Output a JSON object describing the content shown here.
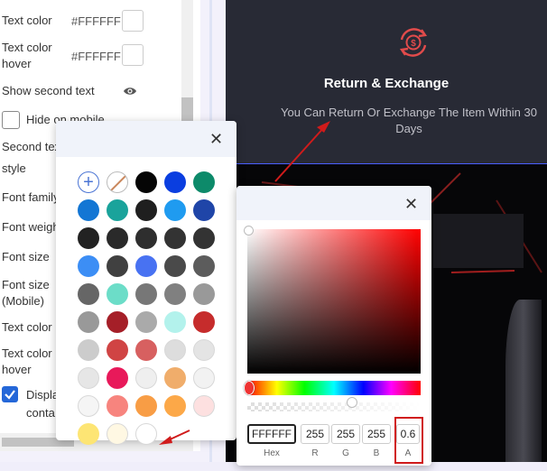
{
  "settings": {
    "text_color_label": "Text color",
    "text_color_value": "#FFFFFF",
    "text_color_hover_label": "Text color hover",
    "text_color_hover_value": "#FFFFFF",
    "show_second_text_label": "Show second text",
    "hide_on_mobile_label": "Hide on mobile",
    "second_text_label": "Second tex",
    "style_label": "style",
    "font_family_label": "Font family",
    "font_weight_label": "Font weigh",
    "font_size_label": "Font size",
    "font_size_mobile_label": "Font size (Mobile)",
    "text_color_label_2": "Text color",
    "text_color_hover_label_2": "Text color hover",
    "display_label": "Displa",
    "display_label_2": "conta",
    "hide_on_mobile_checked": false,
    "display_checked": true
  },
  "preview": {
    "title": "Return & Exchange",
    "text": "You Can Return Or Exchange The Item Within 30 Days",
    "icon": "return-exchange-dollar-icon"
  },
  "swatches": {
    "colors": [
      "#ffffff",
      "#ffffff",
      "#050505",
      "#0a3ee0",
      "#0d8a6a",
      "#1376d4",
      "#1aa39b",
      "#1f1f1f",
      "#1f9bf0",
      "#1f45a8",
      "#222222",
      "#2a2a2a",
      "#2e2e2e",
      "#333333",
      "#333333",
      "#3c8ef5",
      "#404040",
      "#4872f2",
      "#4a4a4a",
      "#5c5c5c",
      "#666666",
      "#6cddc8",
      "#777777",
      "#808080",
      "#999999",
      "#999999",
      "#a51f28",
      "#aaaaaa",
      "#b3f2ec",
      "#c62c2c",
      "#cccccc",
      "#d04444",
      "#d76060",
      "#dddddd",
      "#e4e4e4",
      "#e6e6e6",
      "#e8195a",
      "#efefef",
      "#f0ad6b",
      "#f2f2f2",
      "#f5f5f5",
      "#f7847e",
      "#f89d45",
      "#fca848",
      "#fde0e0",
      "#fde574",
      "#fff8e3",
      "#ffffff"
    ]
  },
  "picker": {
    "hex": "FFFFFF",
    "r": "255",
    "g": "255",
    "b": "255",
    "a": "0.6",
    "hex_label": "Hex",
    "r_label": "R",
    "g_label": "G",
    "b_label": "B",
    "a_label": "A"
  },
  "colors": {
    "accent": "#2467d8",
    "preview_bg": "#282a35",
    "annotation_red": "#d01b1b"
  }
}
